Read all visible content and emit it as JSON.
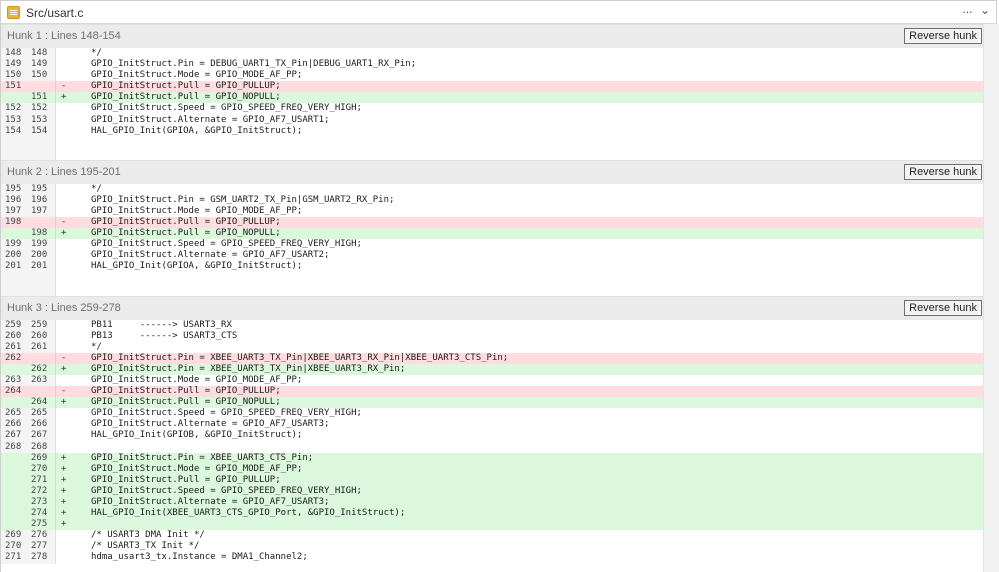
{
  "window": {
    "title": "Src/usart.c",
    "more_glyph": "···",
    "collapse_glyph": "⌄"
  },
  "hunks": [
    {
      "title": "Hunk 1 : Lines 148-154",
      "button_label": "Reverse hunk",
      "lines": [
        {
          "old": "148",
          "new": "148",
          "sign": "",
          "type": "context",
          "code": "*/"
        },
        {
          "old": "149",
          "new": "149",
          "sign": "",
          "type": "context",
          "code": "GPIO_InitStruct.Pin = DEBUG_UART1_TX_Pin|DEBUG_UART1_RX_Pin;"
        },
        {
          "old": "150",
          "new": "150",
          "sign": "",
          "type": "context",
          "code": "GPIO_InitStruct.Mode = GPIO_MODE_AF_PP;"
        },
        {
          "old": "151",
          "new": "",
          "sign": "-",
          "type": "removed",
          "code": "GPIO_InitStruct.Pull = GPIO_PULLUP;"
        },
        {
          "old": "",
          "new": "151",
          "sign": "+",
          "type": "added",
          "code": "GPIO_InitStruct.Pull = GPIO_NOPULL;"
        },
        {
          "old": "152",
          "new": "152",
          "sign": "",
          "type": "context",
          "code": "GPIO_InitStruct.Speed = GPIO_SPEED_FREQ_VERY_HIGH;"
        },
        {
          "old": "153",
          "new": "153",
          "sign": "",
          "type": "context",
          "code": "GPIO_InitStruct.Alternate = GPIO_AF7_USART1;"
        },
        {
          "old": "154",
          "new": "154",
          "sign": "",
          "type": "context",
          "code": "HAL_GPIO_Init(GPIOA, &GPIO_InitStruct);"
        }
      ]
    },
    {
      "title": "Hunk 2 : Lines 195-201",
      "button_label": "Reverse hunk",
      "lines": [
        {
          "old": "195",
          "new": "195",
          "sign": "",
          "type": "context",
          "code": "*/"
        },
        {
          "old": "196",
          "new": "196",
          "sign": "",
          "type": "context",
          "code": "GPIO_InitStruct.Pin = GSM_UART2_TX_Pin|GSM_UART2_RX_Pin;"
        },
        {
          "old": "197",
          "new": "197",
          "sign": "",
          "type": "context",
          "code": "GPIO_InitStruct.Mode = GPIO_MODE_AF_PP;"
        },
        {
          "old": "198",
          "new": "",
          "sign": "-",
          "type": "removed",
          "code": "GPIO_InitStruct.Pull = GPIO_PULLUP;"
        },
        {
          "old": "",
          "new": "198",
          "sign": "+",
          "type": "added",
          "code": "GPIO_InitStruct.Pull = GPIO_NOPULL;"
        },
        {
          "old": "199",
          "new": "199",
          "sign": "",
          "type": "context",
          "code": "GPIO_InitStruct.Speed = GPIO_SPEED_FREQ_VERY_HIGH;"
        },
        {
          "old": "200",
          "new": "200",
          "sign": "",
          "type": "context",
          "code": "GPIO_InitStruct.Alternate = GPIO_AF7_USART2;"
        },
        {
          "old": "201",
          "new": "201",
          "sign": "",
          "type": "context",
          "code": "HAL_GPIO_Init(GPIOA, &GPIO_InitStruct);"
        }
      ]
    },
    {
      "title": "Hunk 3 : Lines 259-278",
      "button_label": "Reverse hunk",
      "lines": [
        {
          "old": "259",
          "new": "259",
          "sign": "",
          "type": "context",
          "code": "PB11     ------> USART3_RX"
        },
        {
          "old": "260",
          "new": "260",
          "sign": "",
          "type": "context",
          "code": "PB13     ------> USART3_CTS"
        },
        {
          "old": "261",
          "new": "261",
          "sign": "",
          "type": "context",
          "code": "*/"
        },
        {
          "old": "262",
          "new": "",
          "sign": "-",
          "type": "removed",
          "code": "GPIO_InitStruct.Pin = XBEE_UART3_TX_Pin|XBEE_UART3_RX_Pin|XBEE_UART3_CTS_Pin;"
        },
        {
          "old": "",
          "new": "262",
          "sign": "+",
          "type": "added",
          "code": "GPIO_InitStruct.Pin = XBEE_UART3_TX_Pin|XBEE_UART3_RX_Pin;"
        },
        {
          "old": "263",
          "new": "263",
          "sign": "",
          "type": "context",
          "code": "GPIO_InitStruct.Mode = GPIO_MODE_AF_PP;"
        },
        {
          "old": "264",
          "new": "",
          "sign": "-",
          "type": "removed",
          "code": "GPIO_InitStruct.Pull = GPIO_PULLUP;"
        },
        {
          "old": "",
          "new": "264",
          "sign": "+",
          "type": "added",
          "code": "GPIO_InitStruct.Pull = GPIO_NOPULL;"
        },
        {
          "old": "265",
          "new": "265",
          "sign": "",
          "type": "context",
          "code": "GPIO_InitStruct.Speed = GPIO_SPEED_FREQ_VERY_HIGH;"
        },
        {
          "old": "266",
          "new": "266",
          "sign": "",
          "type": "context",
          "code": "GPIO_InitStruct.Alternate = GPIO_AF7_USART3;"
        },
        {
          "old": "267",
          "new": "267",
          "sign": "",
          "type": "context",
          "code": "HAL_GPIO_Init(GPIOB, &GPIO_InitStruct);"
        },
        {
          "old": "268",
          "new": "268",
          "sign": "",
          "type": "context",
          "code": ""
        },
        {
          "old": "",
          "new": "269",
          "sign": "+",
          "type": "added",
          "code": "GPIO_InitStruct.Pin = XBEE_UART3_CTS_Pin;"
        },
        {
          "old": "",
          "new": "270",
          "sign": "+",
          "type": "added",
          "code": "GPIO_InitStruct.Mode = GPIO_MODE_AF_PP;"
        },
        {
          "old": "",
          "new": "271",
          "sign": "+",
          "type": "added",
          "code": "GPIO_InitStruct.Pull = GPIO_PULLUP;"
        },
        {
          "old": "",
          "new": "272",
          "sign": "+",
          "type": "added",
          "code": "GPIO_InitStruct.Speed = GPIO_SPEED_FREQ_VERY_HIGH;"
        },
        {
          "old": "",
          "new": "273",
          "sign": "+",
          "type": "added",
          "code": "GPIO_InitStruct.Alternate = GPIO_AF7_USART3;"
        },
        {
          "old": "",
          "new": "274",
          "sign": "+",
          "type": "added",
          "code": "HAL_GPIO_Init(XBEE_UART3_CTS_GPIO_Port, &GPIO_InitStruct);"
        },
        {
          "old": "",
          "new": "275",
          "sign": "+",
          "type": "added",
          "code": ""
        },
        {
          "old": "269",
          "new": "276",
          "sign": "",
          "type": "context",
          "code": "/* USART3 DMA Init */"
        },
        {
          "old": "270",
          "new": "277",
          "sign": "",
          "type": "context",
          "code": "/* USART3_TX Init */"
        },
        {
          "old": "271",
          "new": "278",
          "sign": "",
          "type": "context",
          "code": "hdma_usart3_tx.Instance = DMA1_Channel2;"
        }
      ]
    }
  ]
}
